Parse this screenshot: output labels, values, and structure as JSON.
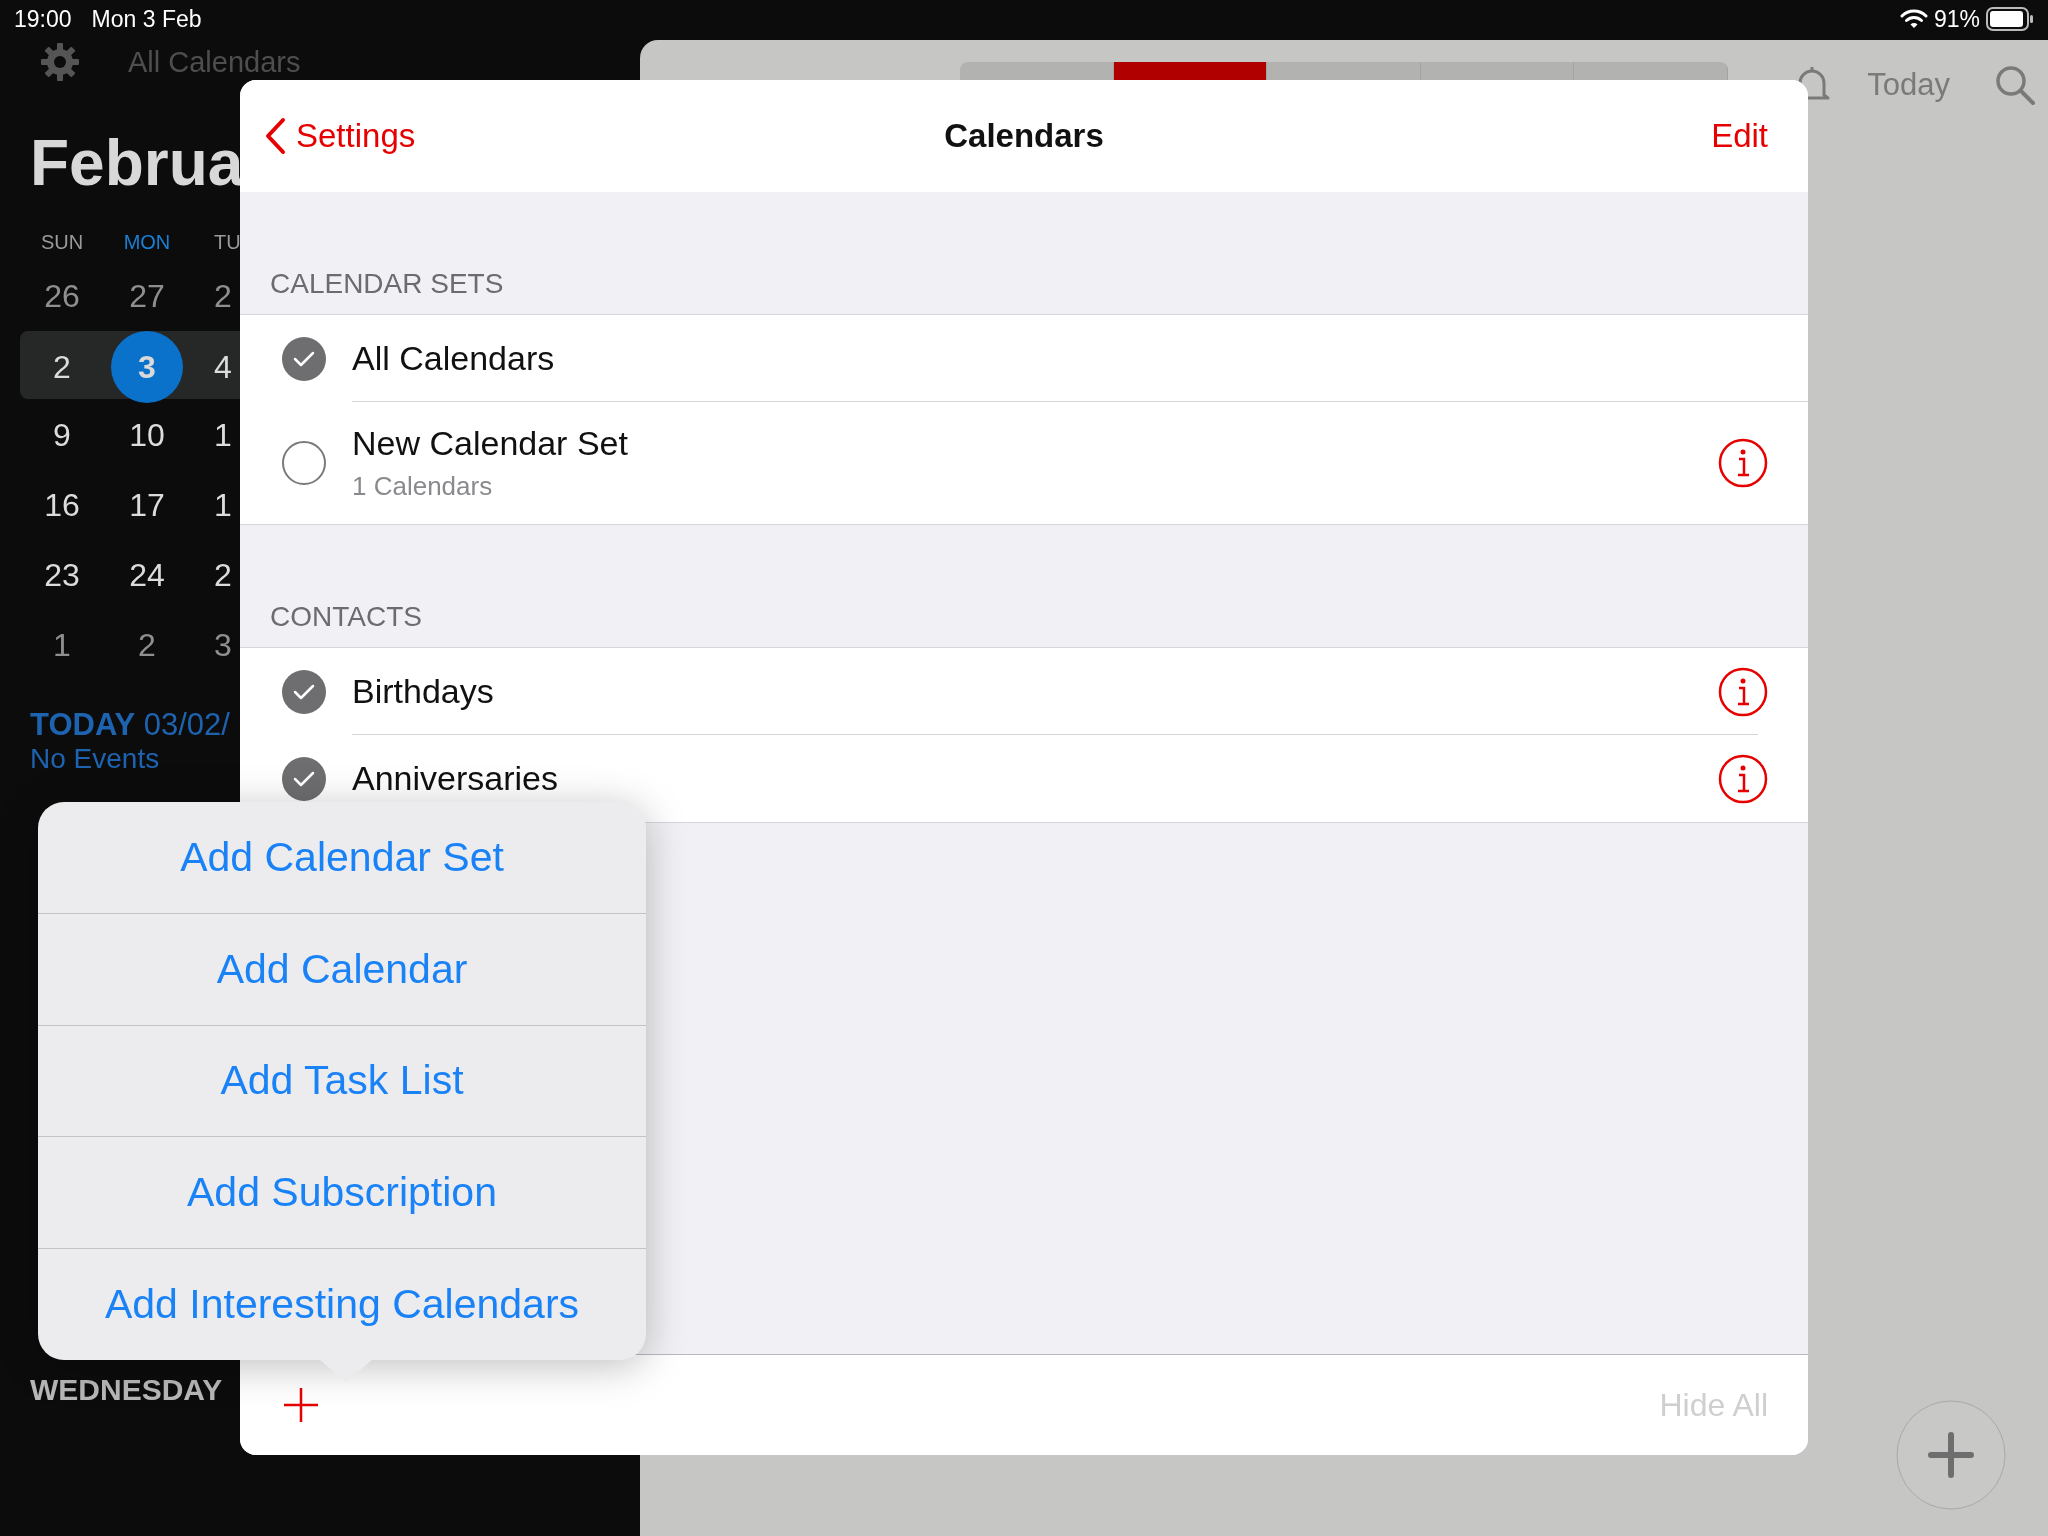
{
  "status_bar": {
    "time": "19:00",
    "date": "Mon 3 Feb",
    "battery": "91%"
  },
  "sidebar": {
    "calendar_filter": "All Calendars",
    "month": "Februa",
    "weekdays": [
      {
        "label": "SUN",
        "selected": false
      },
      {
        "label": "MON",
        "selected": true
      },
      {
        "label": "TU",
        "selected": false
      }
    ],
    "weeks": [
      {
        "selected": false,
        "outside_month": true,
        "days": [
          {
            "label": "26",
            "selected": false
          },
          {
            "label": "27",
            "selected": false
          },
          {
            "label": "2",
            "selected": false
          }
        ]
      },
      {
        "selected": true,
        "outside_month": false,
        "days": [
          {
            "label": "2",
            "selected": false
          },
          {
            "label": "3",
            "selected": true
          },
          {
            "label": "4",
            "selected": false
          }
        ]
      },
      {
        "selected": false,
        "outside_month": false,
        "days": [
          {
            "label": "9",
            "selected": false
          },
          {
            "label": "10",
            "selected": false
          },
          {
            "label": "1",
            "selected": false
          }
        ]
      },
      {
        "selected": false,
        "outside_month": false,
        "days": [
          {
            "label": "16",
            "selected": false
          },
          {
            "label": "17",
            "selected": false
          },
          {
            "label": "1",
            "selected": false
          }
        ]
      },
      {
        "selected": false,
        "outside_month": false,
        "days": [
          {
            "label": "23",
            "selected": false
          },
          {
            "label": "24",
            "selected": false
          },
          {
            "label": "2",
            "selected": false
          }
        ]
      },
      {
        "selected": false,
        "outside_month": true,
        "days": [
          {
            "label": "1",
            "selected": false
          },
          {
            "label": "2",
            "selected": false
          },
          {
            "label": "3",
            "selected": false
          }
        ]
      }
    ],
    "today_label": "TODAY",
    "today_date": "03/02/",
    "no_events": "No Events",
    "day_heading": "WEDNESDAY"
  },
  "toolbar": {
    "segments": [
      {
        "selected": false
      },
      {
        "selected": true
      },
      {
        "selected": false
      },
      {
        "selected": false
      },
      {
        "selected": false
      }
    ],
    "today": "Today"
  },
  "sheet": {
    "back": "Settings",
    "title": "Calendars",
    "edit": "Edit",
    "sections": [
      {
        "header": "CALENDAR SETS",
        "rows": [
          {
            "name": "All Calendars",
            "checked": true,
            "info": false
          },
          {
            "name": "New Calendar Set",
            "subtitle": "1 Calendars",
            "checked": false,
            "info": true
          }
        ]
      },
      {
        "header": "CONTACTS",
        "rows": [
          {
            "name": "Birthdays",
            "checked": true,
            "info": true
          },
          {
            "name": "Anniversaries",
            "checked": true,
            "info": true
          }
        ]
      }
    ],
    "footer": {
      "hide_all": "Hide All",
      "hide_all_disabled": true
    }
  },
  "popover": {
    "items": [
      "Add Calendar Set",
      "Add Calendar",
      "Add Task List",
      "Add Subscription",
      "Add Interesting Calendars"
    ]
  }
}
